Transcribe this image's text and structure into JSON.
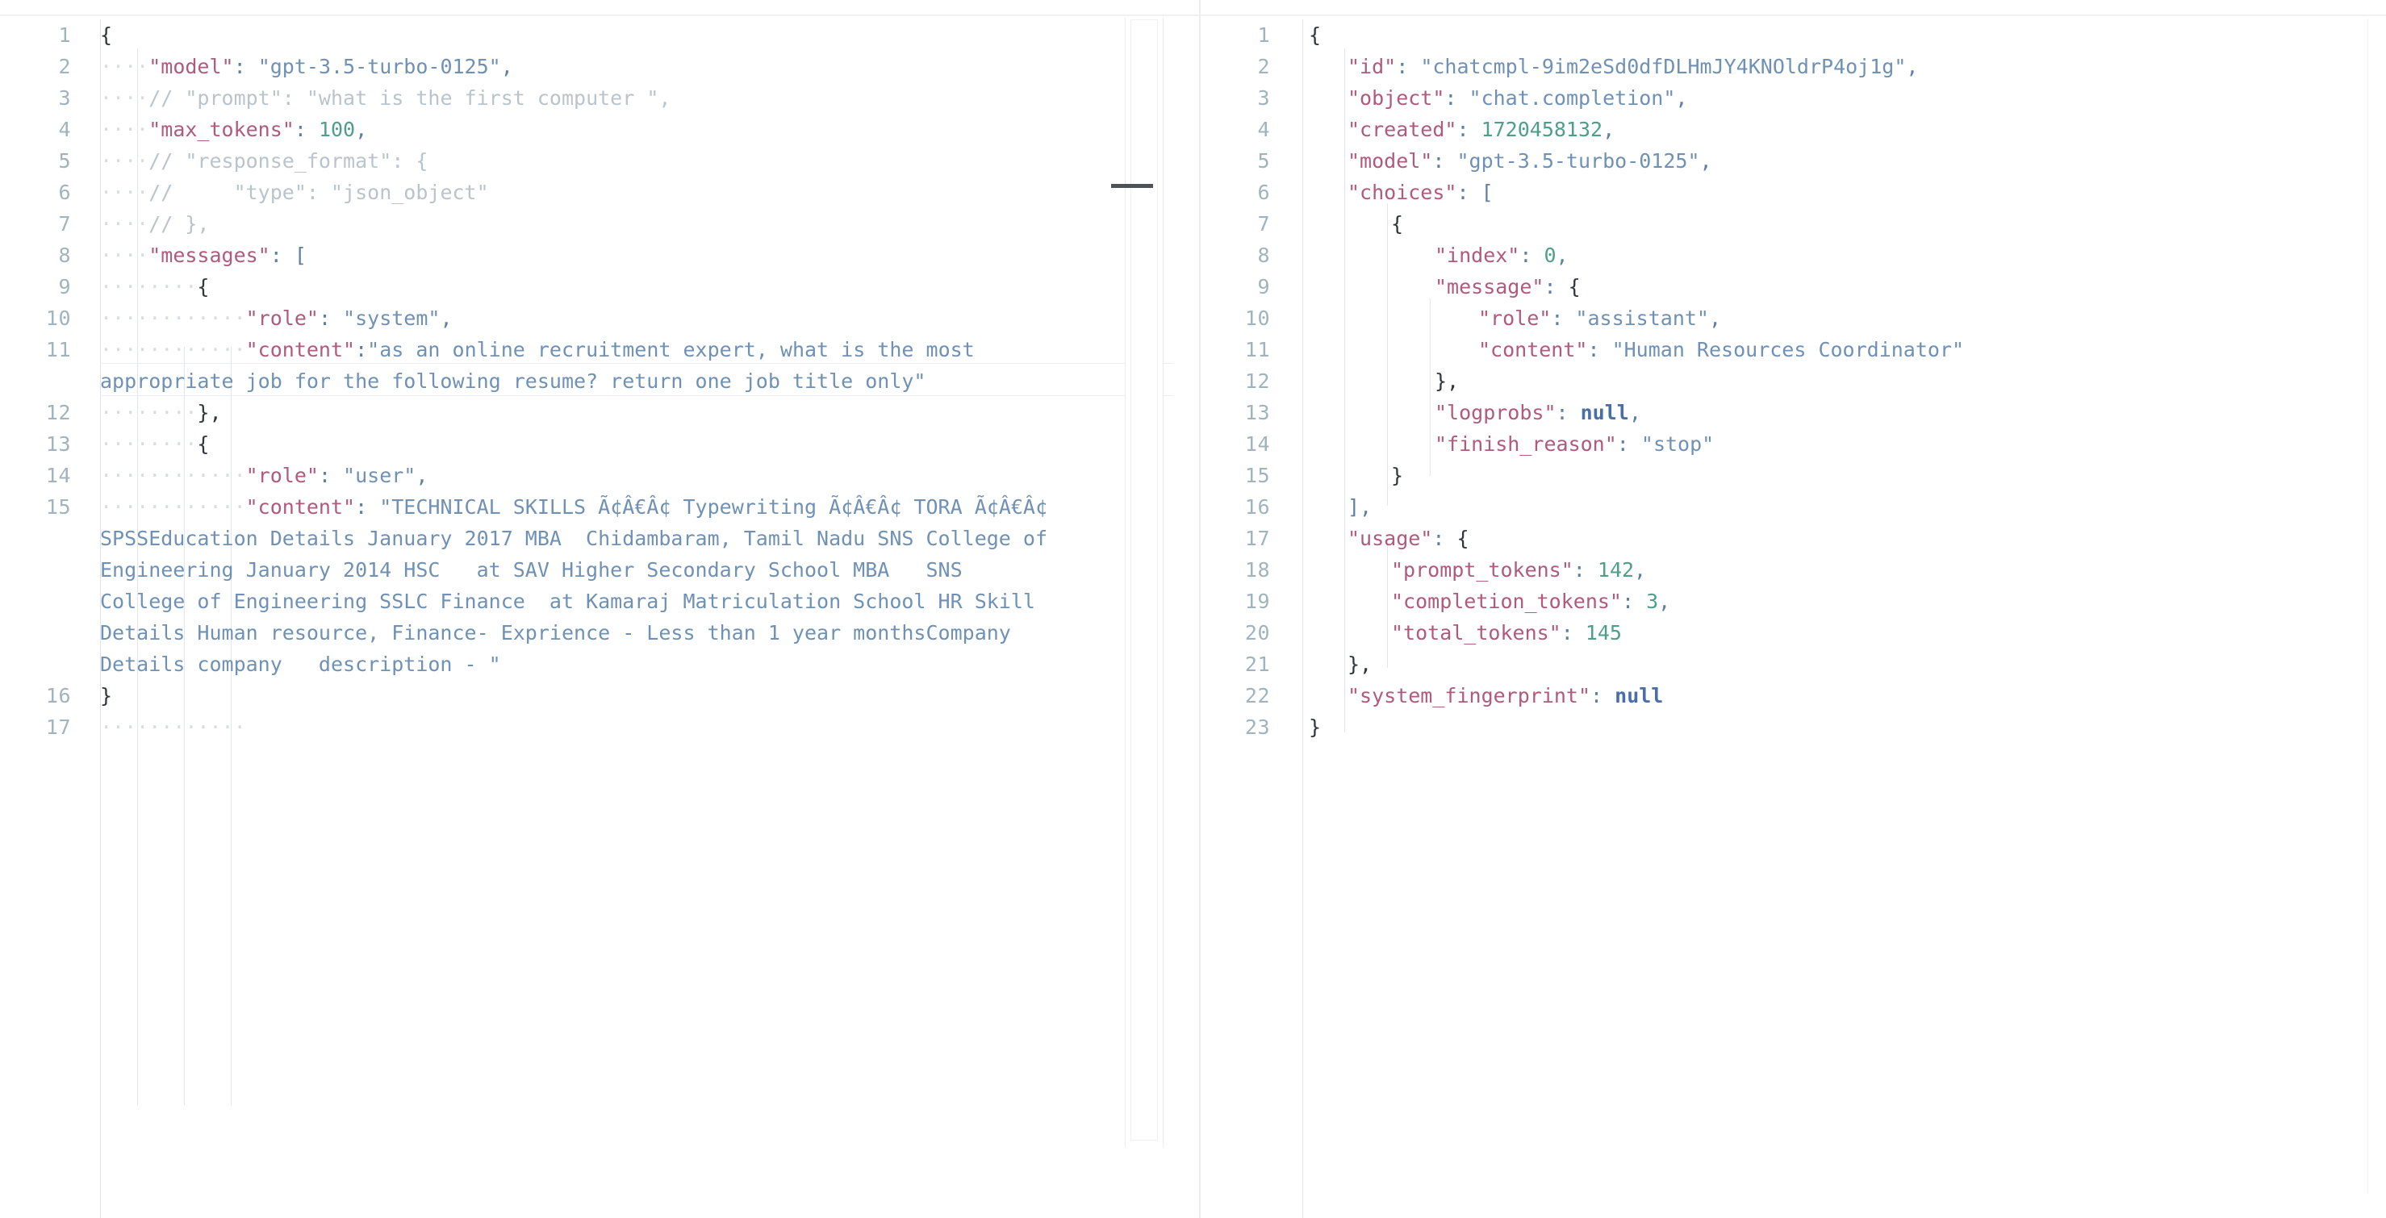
{
  "editor": {
    "title": "JSON request and response side-by-side view",
    "colors": {
      "key": "#b05a7d",
      "string": "#6f91b5",
      "number": "#4f9e8a",
      "keyword": "#4a6fa8",
      "comment": "#b9c4cc",
      "line_number": "#9fb4bd",
      "background": "#ffffff"
    }
  },
  "left_pane": {
    "name": "request-editor",
    "line_numbers": [
      "1",
      "2",
      "3",
      "4",
      "5",
      "6",
      "7",
      "8",
      "9",
      "10",
      "11",
      "12",
      "13",
      "14",
      "15",
      "16",
      "17"
    ],
    "lines": [
      {
        "no": "1",
        "text": "{"
      },
      {
        "no": "2",
        "text": "    \"model\": \"gpt-3.5-turbo-0125\","
      },
      {
        "no": "3",
        "text": "    // \"prompt\": \"what is the first computer \","
      },
      {
        "no": "4",
        "text": "    \"max_tokens\": 100,"
      },
      {
        "no": "5",
        "text": "    // \"response_format\": {"
      },
      {
        "no": "6",
        "text": "    //      \"type\": \"json_object\""
      },
      {
        "no": "7",
        "text": "    // },"
      },
      {
        "no": "8",
        "text": "    \"messages\": ["
      },
      {
        "no": "9",
        "text": "            {"
      },
      {
        "no": "10",
        "text": "                \"role\": \"system\","
      },
      {
        "no": "11",
        "text": "                \"content\":\"as an online recruitment expert, what is the most appropriate job for the following resume? return one job title only\""
      },
      {
        "no": "12",
        "text": "            },"
      },
      {
        "no": "13",
        "text": "            {"
      },
      {
        "no": "14",
        "text": "                \"role\": \"user\","
      },
      {
        "no": "15",
        "text": "                \"content\": \"TECHNICAL SKILLS Ã¢Â€Â¢ Typewriting Ã¢Â€Â¢ TORA Ã¢Â€Â¢ SPSSEducation Details January 2017 MBA  Chidambaram, Tamil Nadu SNS College of Engineering January 2014 HSC   at SAV Higher Secondary School MBA   SNS College of Engineering SSLC Finance  at Kamaraj Matriculation School HR Skill Details Human resource, Finance- Exprience - Less than 1 year monthsCompany Details company   description - \""
      },
      {
        "no": "16",
        "text": "}"
      },
      {
        "no": "17",
        "text": ""
      }
    ],
    "values": {
      "model": "gpt-3.5-turbo-0125",
      "prompt_comment": "what is the first computer ",
      "max_tokens": "100",
      "response_format_type_comment": "json_object",
      "system_role": "system",
      "system_content": "as an online recruitment expert, what is the most appropriate job for the following resume? return one job title only",
      "user_role": "user",
      "user_content": "TECHNICAL SKILLS Ã¢Â€Â¢ Typewriting Ã¢Â€Â¢ TORA Ã¢Â€Â¢ SPSSEducation Details January 2017 MBA  Chidambaram, Tamil Nadu SNS College of Engineering January 2014 HSC   at SAV Higher Secondary School MBA   SNS College of Engineering SSLC Finance  at Kamaraj Matriculation School HR Skill Details Human resource, Finance- Exprience - Less than 1 year monthsCompany Details company   description - "
    },
    "tokens": {
      "l1_brace": "{",
      "l2_dots": "····",
      "l2_key": "\"model\"",
      "l2_colon": ": ",
      "l2_val": "\"gpt-3.5-turbo-0125\"",
      "l2_comma": ",",
      "l3_dots": "····",
      "l3_comment": "// \"prompt\": \"what is the first computer \",",
      "l4_dots": "····",
      "l4_key": "\"max_tokens\"",
      "l4_colon": ": ",
      "l4_val": "100",
      "l4_comma": ",",
      "l5_dots": "····",
      "l5_comment": "// \"response_format\": {",
      "l6_dots": "····",
      "l6_comment": "//     \"type\": \"json_object\"",
      "l7_dots": "····",
      "l7_comment": "// },",
      "l8_dots": "····",
      "l8_key": "\"messages\"",
      "l8_colon": ": ",
      "l8_bracket": "[",
      "l9_dots": "········",
      "l9_brace": "{",
      "l10_dots": "············",
      "l10_key": "\"role\"",
      "l10_colon": ": ",
      "l10_val": "\"system\"",
      "l10_comma": ",",
      "l11_dots": "············",
      "l11_key": "\"content\"",
      "l11_colon": ":",
      "l11_val": "\"as an online recruitment expert, what is the most appropriate job for the following resume? return one job title only\"",
      "l12_dots": "········",
      "l12_brace": "},",
      "l13_dots": "········",
      "l13_brace": "{",
      "l14_dots": "············",
      "l14_key": "\"role\"",
      "l14_colon": ": ",
      "l14_val": "\"user\"",
      "l14_comma": ",",
      "l15_dots": "············",
      "l15_key": "\"content\"",
      "l15_colon": ": ",
      "l15_val": "\"TECHNICAL SKILLS Ã¢Â€Â¢ Typewriting Ã¢Â€Â¢ TORA Ã¢Â€Â¢ SPSSEducation Details January 2017 MBA  Chidambaram, Tamil Nadu SNS College of Engineering January 2014 HSC   at SAV Higher Secondary School MBA   SNS College of Engineering SSLC Finance  at Kamaraj Matriculation School HR Skill Details Human resource, Finance- Exprience - Less than 1 year monthsCompany Details company   description - \"",
      "l16_brace": "}",
      "l17_dots": "············"
    }
  },
  "right_pane": {
    "name": "response-viewer",
    "lines": [
      {
        "no": "1",
        "text": "{"
      },
      {
        "no": "2",
        "text": "    \"id\": \"chatcmpl-9im2eSd0dfDLHmJY4KNOldrP4oj1g\","
      },
      {
        "no": "3",
        "text": "    \"object\": \"chat.completion\","
      },
      {
        "no": "4",
        "text": "    \"created\": 1720458132,"
      },
      {
        "no": "5",
        "text": "    \"model\": \"gpt-3.5-turbo-0125\","
      },
      {
        "no": "6",
        "text": "    \"choices\": ["
      },
      {
        "no": "7",
        "text": "        {"
      },
      {
        "no": "8",
        "text": "            \"index\": 0,"
      },
      {
        "no": "9",
        "text": "            \"message\": {"
      },
      {
        "no": "10",
        "text": "                \"role\": \"assistant\","
      },
      {
        "no": "11",
        "text": "                \"content\": \"Human Resources Coordinator\""
      },
      {
        "no": "12",
        "text": "            },"
      },
      {
        "no": "13",
        "text": "            \"logprobs\": null,"
      },
      {
        "no": "14",
        "text": "            \"finish_reason\": \"stop\""
      },
      {
        "no": "15",
        "text": "        }"
      },
      {
        "no": "16",
        "text": "    ],"
      },
      {
        "no": "17",
        "text": "    \"usage\": {"
      },
      {
        "no": "18",
        "text": "        \"prompt_tokens\": 142,"
      },
      {
        "no": "19",
        "text": "        \"completion_tokens\": 3,"
      },
      {
        "no": "20",
        "text": "        \"total_tokens\": 145"
      },
      {
        "no": "21",
        "text": "    },"
      },
      {
        "no": "22",
        "text": "    \"system_fingerprint\": null"
      },
      {
        "no": "23",
        "text": "}"
      }
    ],
    "values": {
      "id": "chatcmpl-9im2eSd0dfDLHmJY4KNOldrP4oj1g",
      "object": "chat.completion",
      "created": "1720458132",
      "model": "gpt-3.5-turbo-0125",
      "index": "0",
      "role": "assistant",
      "content": "Human Resources Coordinator",
      "logprobs": "null",
      "finish_reason": "stop",
      "prompt_tokens": "142",
      "completion_tokens": "3",
      "total_tokens": "145",
      "system_fingerprint": "null"
    },
    "tokens": {
      "r1_brace": "{",
      "r2_key": "\"id\"",
      "r2_colon": ": ",
      "r2_val": "\"chatcmpl-9im2eSd0dfDLHmJY4KNOldrP4oj1g\"",
      "r2_comma": ",",
      "r3_key": "\"object\"",
      "r3_colon": ": ",
      "r3_val": "\"chat.completion\"",
      "r3_comma": ",",
      "r4_key": "\"created\"",
      "r4_colon": ": ",
      "r4_val": "1720458132",
      "r4_comma": ",",
      "r5_key": "\"model\"",
      "r5_colon": ": ",
      "r5_val": "\"gpt-3.5-turbo-0125\"",
      "r5_comma": ",",
      "r6_key": "\"choices\"",
      "r6_colon": ": ",
      "r6_bracket": "[",
      "r7_brace": "{",
      "r8_key": "\"index\"",
      "r8_colon": ": ",
      "r8_val": "0",
      "r8_comma": ",",
      "r9_key": "\"message\"",
      "r9_colon": ": ",
      "r9_brace": "{",
      "r10_key": "\"role\"",
      "r10_colon": ": ",
      "r10_val": "\"assistant\"",
      "r10_comma": ",",
      "r11_key": "\"content\"",
      "r11_colon": ": ",
      "r11_val": "\"Human Resources Coordinator\"",
      "r12_brace": "},",
      "r13_key": "\"logprobs\"",
      "r13_colon": ": ",
      "r13_val": "null",
      "r13_comma": ",",
      "r14_key": "\"finish_reason\"",
      "r14_colon": ": ",
      "r14_val": "\"stop\"",
      "r15_brace": "}",
      "r16_bracket": "],",
      "r17_key": "\"usage\"",
      "r17_colon": ": ",
      "r17_brace": "{",
      "r18_key": "\"prompt_tokens\"",
      "r18_colon": ": ",
      "r18_val": "142",
      "r18_comma": ",",
      "r19_key": "\"completion_tokens\"",
      "r19_colon": ": ",
      "r19_val": "3",
      "r19_comma": ",",
      "r20_key": "\"total_tokens\"",
      "r20_colon": ": ",
      "r20_val": "145",
      "r21_brace": "},",
      "r22_key": "\"system_fingerprint\"",
      "r22_colon": ": ",
      "r22_val": "null",
      "r23_brace": "}"
    }
  }
}
